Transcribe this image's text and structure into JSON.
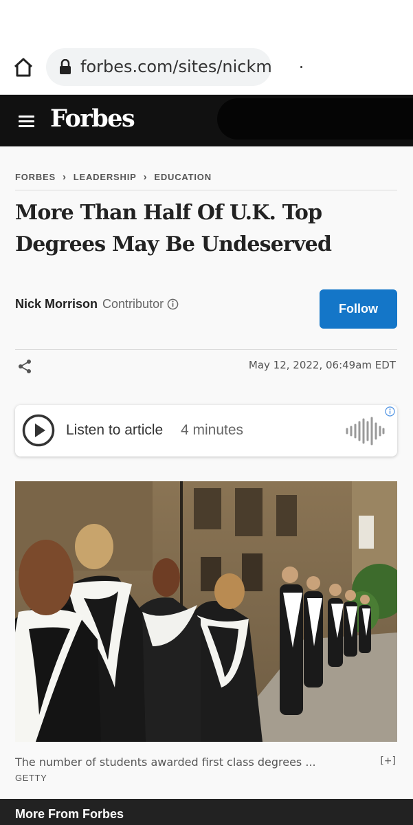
{
  "browser": {
    "url": "forbes.com/sites/nickm",
    "icons": {
      "home": "home-icon",
      "lock": "lock-icon"
    }
  },
  "header": {
    "logo": "Forbes",
    "icons": {
      "menu": "hamburger-menu-icon"
    },
    "background_color": "#111111"
  },
  "breadcrumb": [
    "FORBES",
    "LEADERSHIP",
    "EDUCATION"
  ],
  "article": {
    "headline": "More Than Half Of U.K. Top Degrees May Be Undeserved",
    "author": "Nick Morrison",
    "author_role": "Contributor",
    "follow_label": "Follow",
    "date": "May 12, 2022, 06:49am EDT"
  },
  "audio": {
    "label": "Listen to article",
    "duration": "4 minutes"
  },
  "image": {
    "caption": "The number of students awarded first class degrees ...",
    "expand": "[+]",
    "credit": "GETTY"
  },
  "footer": {
    "label": "More From Forbes"
  },
  "colors": {
    "accent": "#1476c8",
    "header": "#111111",
    "footer": "#222222"
  }
}
